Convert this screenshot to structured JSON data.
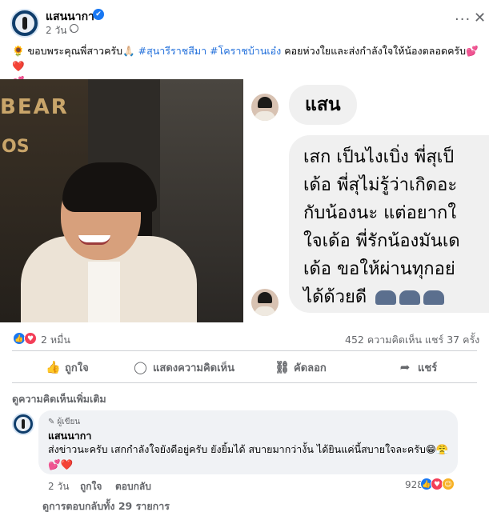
{
  "post": {
    "page_name": "แสนนากา",
    "time": "2 วัน ·",
    "caption": {
      "prefix_emoji": "🌻",
      "text_before_tags": " ขอบพระคุณพี่สาวครับ🙏🏻 ",
      "tag1": "#สุนารีราชสีมา",
      "tag2": "#โคราชบ้านเอ๋ง",
      "text_after_tags": " คอยห่วงใยและส่งกำลังใจให้น้องตลอดครับ",
      "hearts_line1": "💕❤️",
      "hearts_line2": "💕"
    }
  },
  "media": {
    "photo_sign_text": "BEAR",
    "photo_sign_text2": "OS",
    "chat": {
      "name_bubble": "แสน",
      "message_lines": [
        "เสก เป็นไงเบิ่ง พี่สุเป็",
        "เด้อ พี่สุไม่รู้ว่าเกิดอะ",
        "กับน้องนะ แต่อยากใ",
        "ใจเด้อ พี่รักน้องมันเด",
        "เด้อ ขอให้ผ่านทุกอย่",
        "ได้ด้วยดี"
      ]
    }
  },
  "stats": {
    "reactions": "2 หมื่น",
    "comments": "452 ความคิดเห็น",
    "shares": "แชร์ 37 ครั้ง"
  },
  "actions": {
    "like": "ถูกใจ",
    "comment": "แสดงความคิดเห็น",
    "copy": "คัดลอก",
    "share": "แชร์"
  },
  "more_comments": "ดูความคิดเห็นเพิ่มเติม",
  "comment": {
    "badge": "ผู้เขียน",
    "author": "แสนนากา",
    "text": "ส่งข่าวนะครับ เสกกำลังใจยังดีอยู่ครับ ยังยิ้มได้ สบายมากว่างั้น ได้ยินแค่นี้สบายใจละครับ😁😤",
    "hearts": "💕❤️",
    "time": "2 วัน",
    "like": "ถูกใจ",
    "reply": "ตอบกลับ",
    "reaction_count": "928"
  },
  "view_replies": "ดูการตอบกลับทั้ง 29 รายการ",
  "icons": {
    "verified": "verified-badge-icon",
    "globe": "globe-icon",
    "more": "more-horizontal-icon",
    "close": "close-icon",
    "like": "thumbs-up-icon",
    "comment": "comment-bubble-icon",
    "copy": "link-icon",
    "share": "share-arrow-icon"
  },
  "colors": {
    "link_blue": "#216fdb",
    "facebook_blue": "#1877f2",
    "love_red": "#f33e58",
    "muted_text": "#65676b"
  }
}
